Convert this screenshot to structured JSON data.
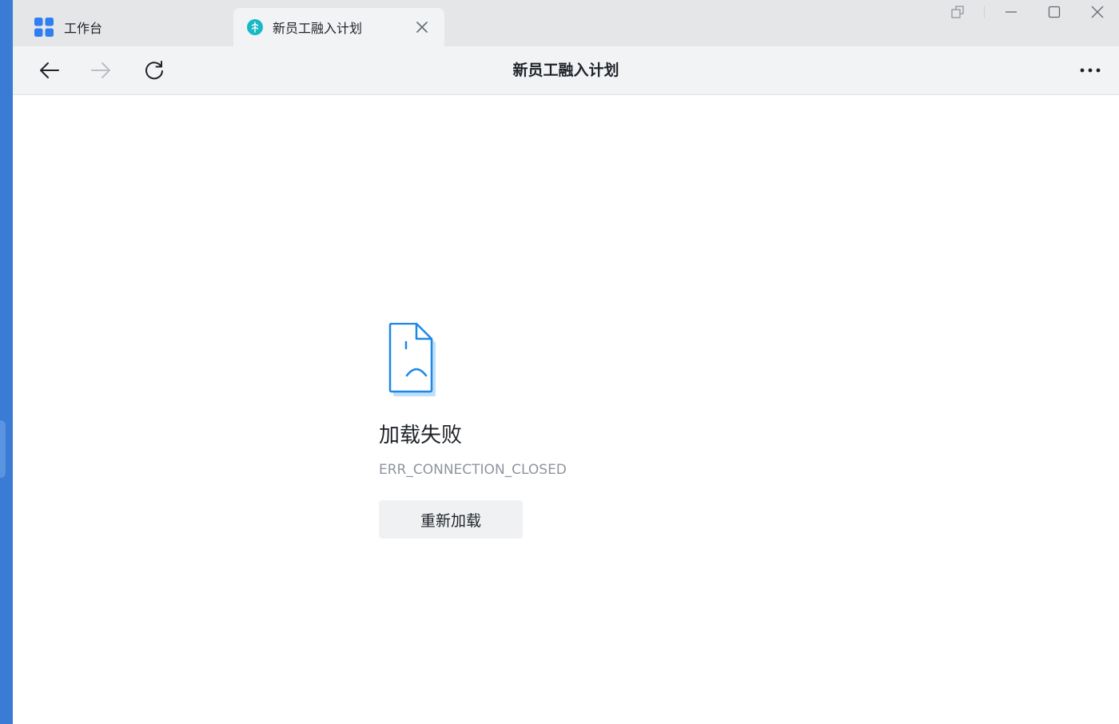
{
  "tabs": {
    "home": {
      "label": "工作台",
      "icon": "grid-apps-icon"
    },
    "active": {
      "label": "新员工融入计划",
      "icon": "app-logo-icon"
    }
  },
  "navbar": {
    "title": "新员工融入计划"
  },
  "error": {
    "title": "加载失败",
    "code": "ERR_CONNECTION_CLOSED",
    "reload_label": "重新加载",
    "icon": "sad-file-icon"
  },
  "colors": {
    "accent": "#3a7bd5",
    "icon_blue": "#1e88e5"
  }
}
